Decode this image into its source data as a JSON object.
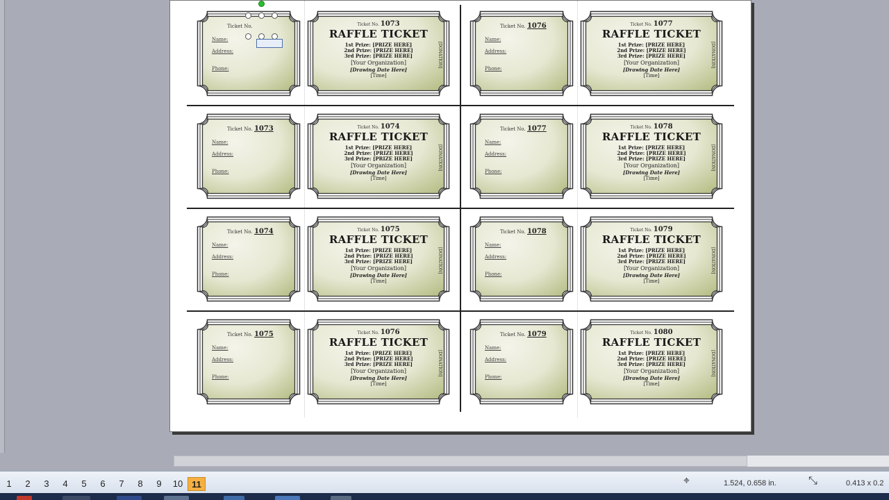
{
  "ticket": {
    "no_label": "Ticket No.",
    "title": "RAFFLE TICKET",
    "name_label": "Name:",
    "address_label": "Address:",
    "phone_label": "Phone:",
    "prize1": "1st Prize: [PRIZE HERE]",
    "prize2": "2nd Prize: [PRIZE HERE]",
    "prize3": "3rd Prize: [PRIZE HERE]",
    "org": "[Your Organization]",
    "date": "[Drawing Date Here]",
    "time": "[Time]",
    "side": "[DONATION]"
  },
  "rows": [
    {
      "stub1": "",
      "main1": "1073",
      "stub2": "1076",
      "main2": "1077"
    },
    {
      "stub1": "1073",
      "main1": "1074",
      "stub2": "1077",
      "main2": "1078"
    },
    {
      "stub1": "1074",
      "main1": "1075",
      "stub2": "1078",
      "main2": "1079"
    },
    {
      "stub1": "1075",
      "main1": "1076",
      "stub2": "1079",
      "main2": "1080"
    }
  ],
  "pages": [
    "1",
    "2",
    "3",
    "4",
    "5",
    "6",
    "7",
    "8",
    "9",
    "10",
    "11"
  ],
  "active_page": "11",
  "status": {
    "position": "1.524, 0.658 in.",
    "size": "0.413 x 0.2"
  },
  "colors": {
    "ticket_fill_light": "#f4f4ea",
    "ticket_fill_dark": "#b9c08a",
    "active_page": "#f6b042"
  }
}
